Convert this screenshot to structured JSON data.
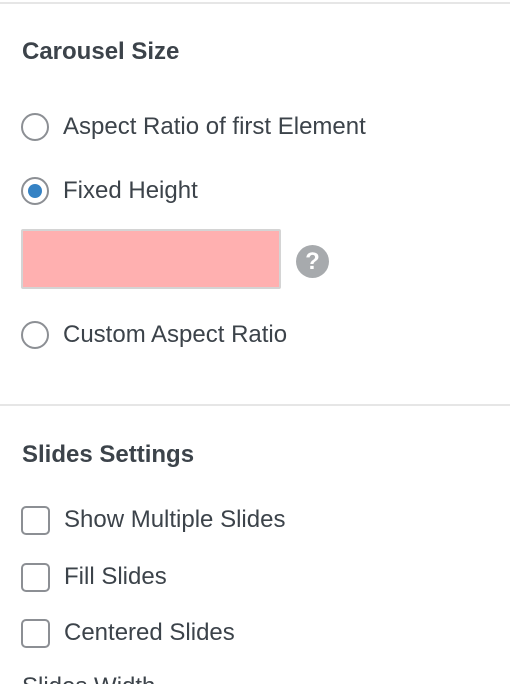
{
  "carousel_size": {
    "title": "Carousel Size",
    "options": [
      {
        "label": "Aspect Ratio of first Element",
        "selected": false
      },
      {
        "label": "Fixed Height",
        "selected": true
      },
      {
        "label": "Custom Aspect Ratio",
        "selected": false
      }
    ],
    "height_input": {
      "value": "",
      "background_color": "#ffb0b0"
    },
    "help_icon": {
      "icon": "question-mark-icon",
      "glyph": "?"
    }
  },
  "slides_settings": {
    "title": "Slides Settings",
    "checkboxes": [
      {
        "label": "Show Multiple Slides",
        "checked": false
      },
      {
        "label": "Fill Slides",
        "checked": false
      },
      {
        "label": "Centered Slides",
        "checked": false
      }
    ],
    "next_label_partial": "Slides Width"
  },
  "colors": {
    "radio_selected": "#3582c4",
    "text": "#3c434a",
    "help_icon_bg": "#a7aaad"
  }
}
